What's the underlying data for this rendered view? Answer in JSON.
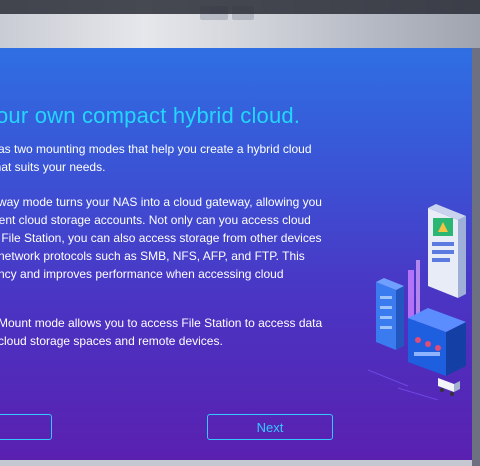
{
  "dialog": {
    "headline": "our own compact hybrid cloud.",
    "para1": " has two mounting modes that help you create a hybrid cloud\n that suits your needs.",
    "para2": "teway mode turns your NAS into a cloud gateway, allowing you\nerent cloud storage accounts. Not only can you access cloud\nm File Station, you can also access storage from other devices\na network protocols such as SMB, NFS, AFP, and FTP. This\ntency and improves performance when accessing cloud",
    "para3": "e Mount mode allows you to access File Station to access data\nd cloud storage spaces and remote devices.",
    "back_label": "",
    "next_label": "Next"
  },
  "colors": {
    "accent": "#35c8ff",
    "headline": "#23d6ff",
    "gradient_top": "#2f6fe3",
    "gradient_bottom": "#5a20b0"
  },
  "icons": {
    "illustration": "hybrid-cloud-illustration"
  }
}
